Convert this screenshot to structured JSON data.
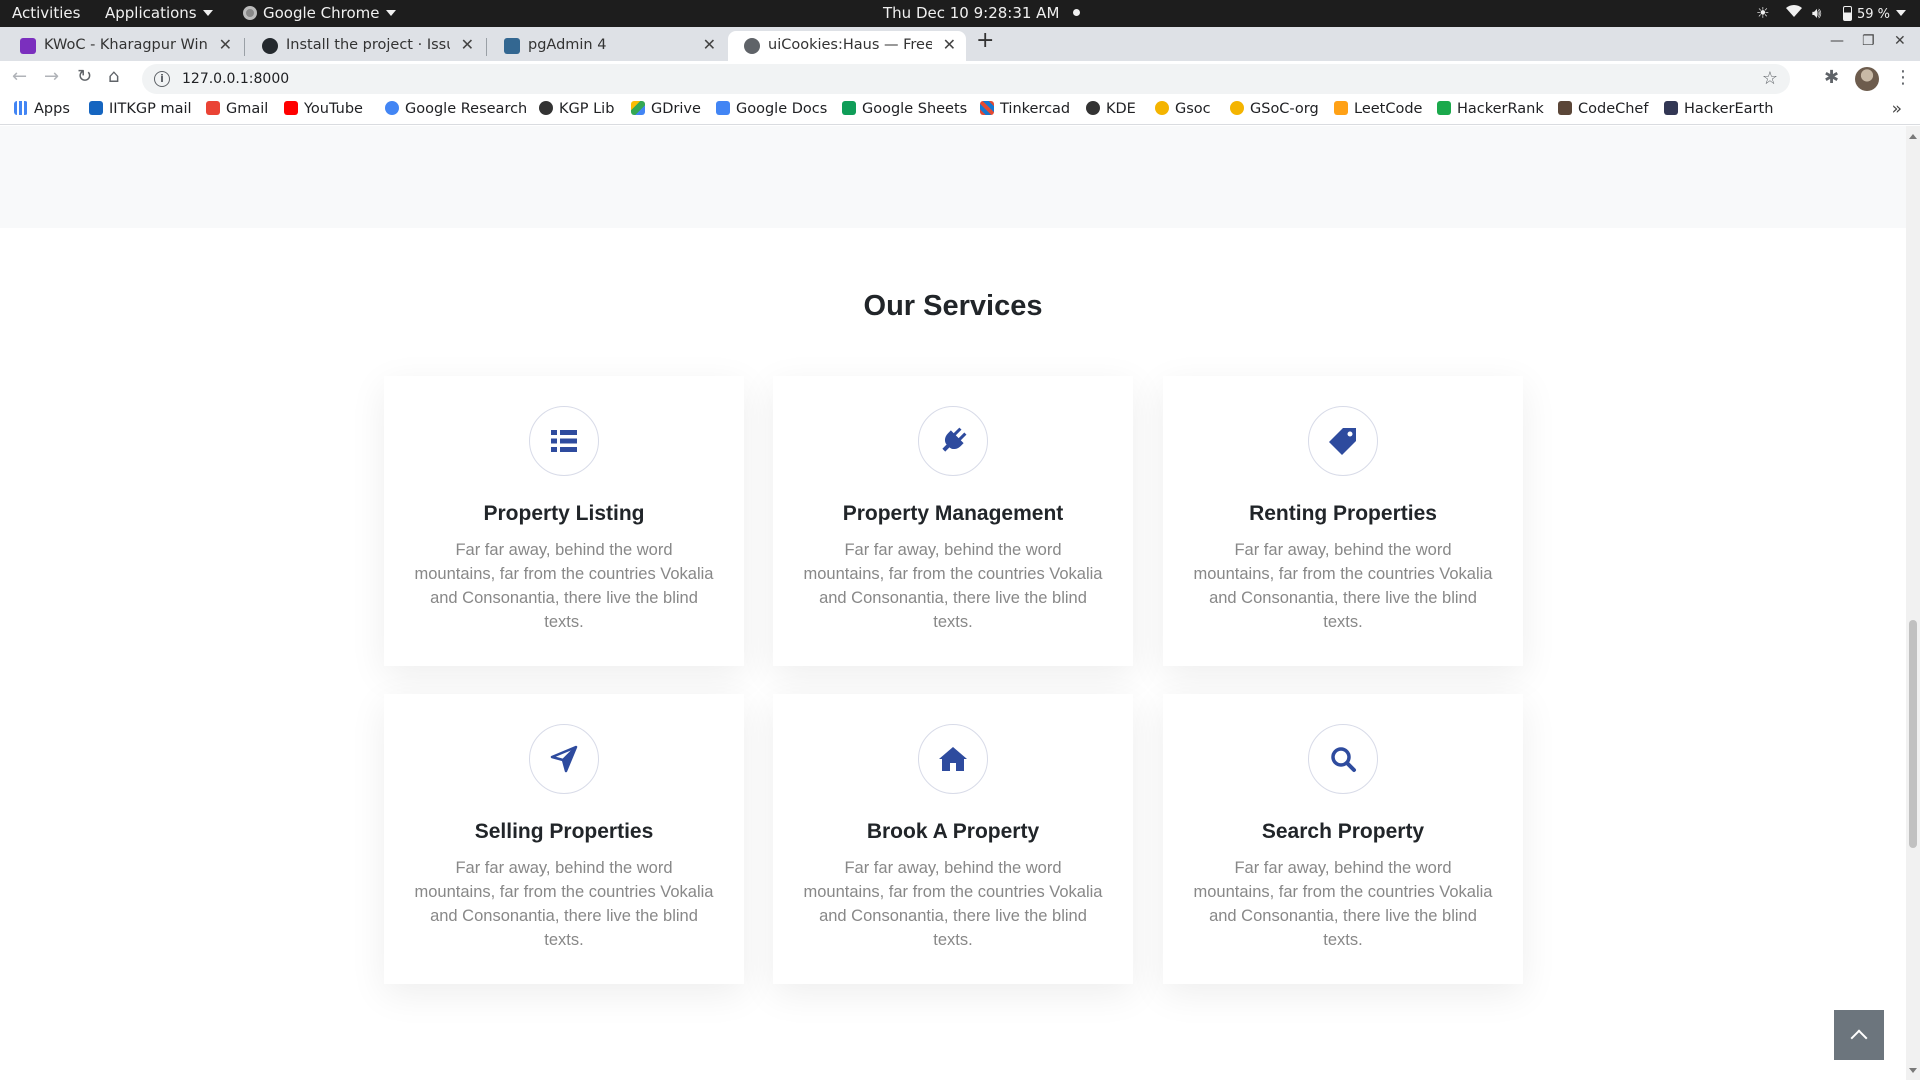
{
  "topbar": {
    "activities": "Activities",
    "applications": "Applications",
    "app_name": "Google Chrome",
    "clock": "Thu Dec 10  9:28:31 AM",
    "battery": "59 %"
  },
  "tabs": [
    {
      "title": "KWoC - Kharagpur Winter",
      "icon_color": "#7b2fbe"
    },
    {
      "title": "Install the project · Issue #",
      "icon_color": "#24292e"
    },
    {
      "title": "pgAdmin 4",
      "icon_color": "#336791"
    },
    {
      "title": "uiCookies:Haus — Free Bo",
      "icon_color": "#5f6368"
    }
  ],
  "toolbar": {
    "url": "127.0.0.1:8000"
  },
  "bookmarks": [
    {
      "label": "Apps",
      "color": "#1a73e8"
    },
    {
      "label": "IITKGP mail",
      "color": "#1565c0"
    },
    {
      "label": "Gmail",
      "color": "#ea4335"
    },
    {
      "label": "YouTube",
      "color": "#ff0000"
    },
    {
      "label": "Google Research",
      "color": "#4285f4"
    },
    {
      "label": "KGP Lib",
      "color": "#333333"
    },
    {
      "label": "GDrive",
      "color": "#34a853"
    },
    {
      "label": "Google Docs",
      "color": "#4285f4"
    },
    {
      "label": "Google Sheets",
      "color": "#0f9d58"
    },
    {
      "label": "Tinkercad",
      "color": "#e24a33"
    },
    {
      "label": "KDE",
      "color": "#333333"
    },
    {
      "label": "Gsoc",
      "color": "#f4b400"
    },
    {
      "label": "GSoC-org",
      "color": "#f4b400"
    },
    {
      "label": "LeetCode",
      "color": "#ffa116"
    },
    {
      "label": "HackerRank",
      "color": "#1ba94c"
    },
    {
      "label": "CodeChef",
      "color": "#5b4638"
    },
    {
      "label": "HackerEarth",
      "color": "#323754"
    }
  ],
  "services": {
    "title": "Our Services",
    "accent": "#2e4b9e",
    "items": [
      {
        "title": "Property Listing",
        "icon": "list-icon",
        "text": "Far far away, behind the word mountains, far from the countries Vokalia and Consonantia, there live the blind texts."
      },
      {
        "title": "Property Management",
        "icon": "plug-icon",
        "text": "Far far away, behind the word mountains, far from the countries Vokalia and Consonantia, there live the blind texts."
      },
      {
        "title": "Renting Properties",
        "icon": "tag-icon",
        "text": "Far far away, behind the word mountains, far from the countries Vokalia and Consonantia, there live the blind texts."
      },
      {
        "title": "Selling Properties",
        "icon": "paper-plane-icon",
        "text": "Far far away, behind the word mountains, far from the countries Vokalia and Consonantia, there live the blind texts."
      },
      {
        "title": "Brook A Property",
        "icon": "home-icon",
        "text": "Far far away, behind the word mountains, far from the countries Vokalia and Consonantia, there live the blind texts."
      },
      {
        "title": "Search Property",
        "icon": "search-icon",
        "text": "Far far away, behind the word mountains, far from the countries Vokalia and Consonantia, there live the blind texts."
      }
    ]
  }
}
